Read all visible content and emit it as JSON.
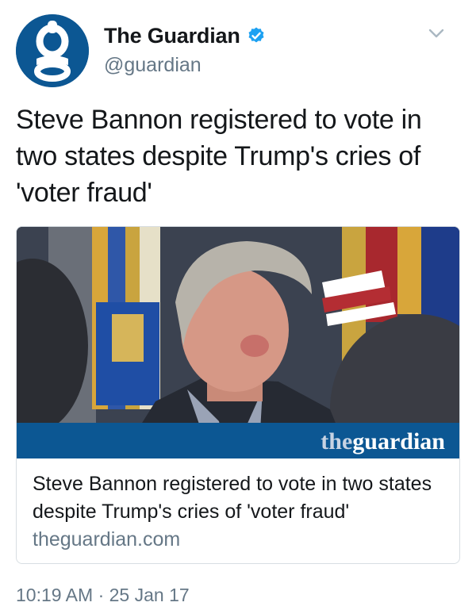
{
  "account": {
    "display_name": "The Guardian",
    "handle": "@guardian",
    "verified": true,
    "avatar_letter": "g",
    "brand_color": "#0c5793"
  },
  "tweet": {
    "text": "Steve Bannon registered to vote in two states despite Trump's cries of 'voter fraud'",
    "timestamp": "10:19 AM · 25 Jan 17"
  },
  "card": {
    "image_wordmark_the": "the",
    "image_wordmark_guardian": "guardian",
    "title": "Steve Bannon registered to vote in two states despite Trump's cries of 'voter fraud'",
    "domain": "theguardian.com"
  },
  "icons": {
    "verified": "verified-badge-icon",
    "menu": "chevron-down-icon"
  },
  "colors": {
    "text_primary": "#14171a",
    "text_secondary": "#657786",
    "verified_blue": "#1da1f2",
    "guardian_blue": "#0c5793",
    "border": "#d8dee3"
  }
}
